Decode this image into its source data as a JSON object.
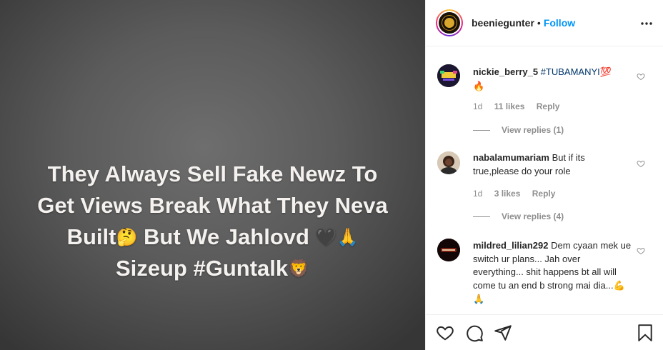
{
  "post": {
    "text_lines": [
      "They Always Sell Fake Newz To",
      "Get Views Break What They Neva",
      "Built",
      "But We Jahlovd",
      "Sizeup #Guntalk"
    ],
    "emoji_thinking": "🤔",
    "emoji_heart": "🖤",
    "emoji_pray": "🙏",
    "emoji_lion": "🦁"
  },
  "header": {
    "username": "beeniegunter",
    "separator": "•",
    "follow_label": "Follow",
    "more_label": "•••"
  },
  "comments": [
    {
      "username": "nickie_berry_5",
      "hashtag": "#TUBAMANYI",
      "emoji": "💯",
      "emoji2": "🔥",
      "time": "1d",
      "likes": "11 likes",
      "reply_label": "Reply",
      "view_replies": "View replies (1)"
    },
    {
      "username": "nabalamumariam",
      "text": "But if its true,please do your role",
      "time": "1d",
      "likes": "3 likes",
      "reply_label": "Reply",
      "view_replies": "View replies (4)"
    },
    {
      "username": "mildred_lilian292",
      "text": "Dem cyaan mek ue switch ur plans... Jah over everything... shit happens bt all will come tu an end b strong mai dia...",
      "emoji": "💪🙏"
    }
  ],
  "colors": {
    "link_blue": "#0095f6",
    "hashtag_blue": "#00376b",
    "muted": "#8e8e8e",
    "text": "#262626"
  },
  "icons": [
    "heart-icon",
    "comment-icon",
    "share-icon",
    "bookmark-icon",
    "more-icon"
  ]
}
